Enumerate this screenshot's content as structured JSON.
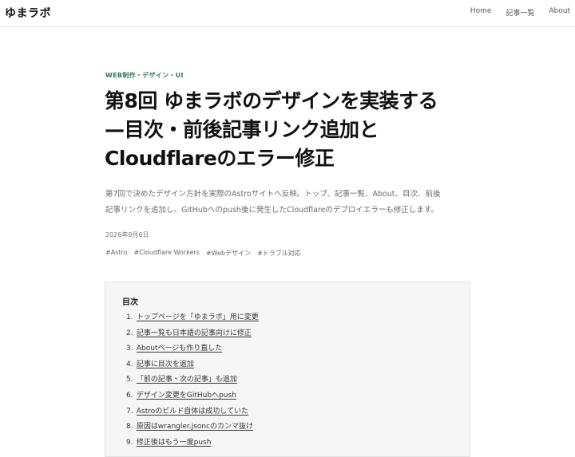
{
  "header": {
    "logo": "ゆまラボ",
    "nav": [
      {
        "label": "Home"
      },
      {
        "label": "記事一覧"
      },
      {
        "label": "About"
      }
    ]
  },
  "article": {
    "category": "WEB制作・デザイン・UI",
    "title_lines": [
      "第8回 ゆまラボのデザインを実装する",
      "—目次・前後記事リンク追加と",
      "Cloudflareのエラー修正"
    ],
    "lead_lines": [
      "第7回で決めたデザイン方針を実際のAstroサイトへ反映。トップ、記事一覧、About、目次、前後",
      "記事リンクを追加し、GitHubへのpush後に発生したCloudflareのデプロイエラーも修正します。"
    ],
    "date": "2026年9月6日",
    "tags": [
      "#Astro",
      "#Cloudflare Workers",
      "#Webデザイン",
      "#トラブル対応"
    ]
  },
  "toc": {
    "title": "目次",
    "items": [
      {
        "num": "1.",
        "label": "トップページを「ゆまラボ」用に変更"
      },
      {
        "num": "2.",
        "label": "記事一覧も日本語の記事向けに修正"
      },
      {
        "num": "3.",
        "label": "Aboutページも作り直した"
      },
      {
        "num": "4.",
        "label": "記事に目次を追加"
      },
      {
        "num": "5.",
        "label": "「前の記事・次の記事」も追加"
      },
      {
        "num": "6.",
        "label": "デザイン変更をGitHubへpush"
      },
      {
        "num": "7.",
        "label": "Astroのビルド自体は成功していた"
      },
      {
        "num": "8.",
        "label": "原因はwrangler.jsoncのカンマ抜け"
      },
      {
        "num": "9.",
        "label": "修正後はもう一度push"
      }
    ]
  }
}
